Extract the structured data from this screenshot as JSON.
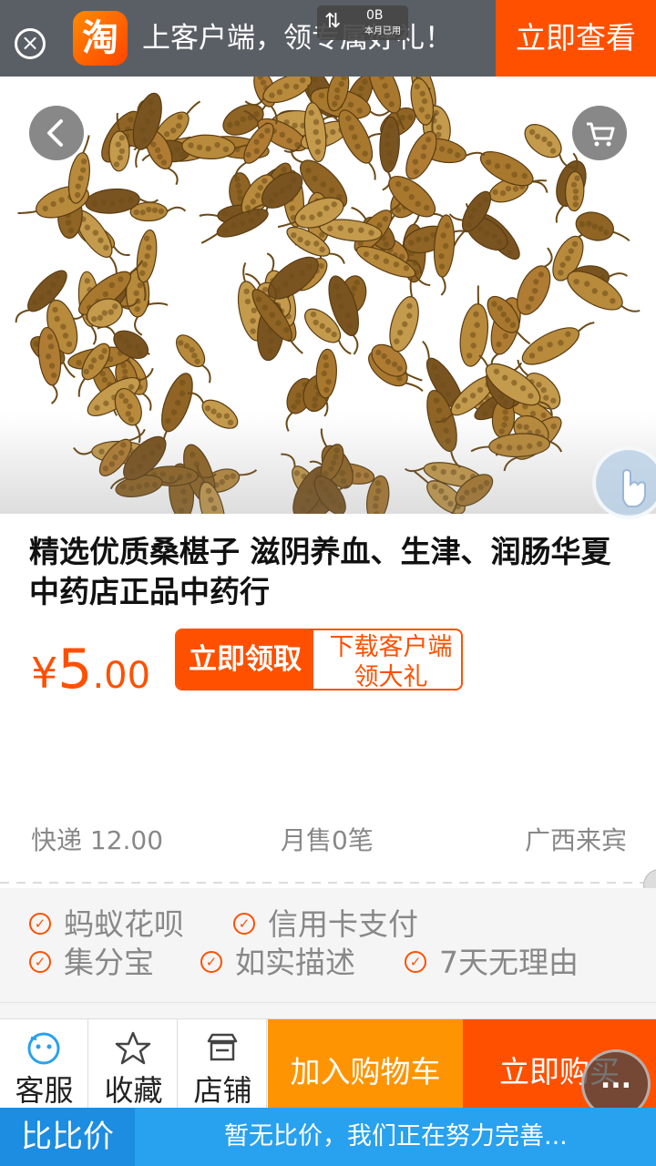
{
  "banner": {
    "logo_char": "淘",
    "text": "上客户端，领专属好礼！",
    "cta": "立即查看",
    "colors": {
      "bg": "#5a5f65",
      "cta": "#ff5000"
    }
  },
  "data_usage": {
    "amount": "0B",
    "label": "本月已用"
  },
  "product": {
    "title": "精选优质桑椹子 滋阴养血、生津、润肠华夏中药店正品中药行",
    "price_symbol": "¥",
    "price_integer": "5",
    "price_decimal": ".00"
  },
  "coupon": {
    "button": "立即领取",
    "desc": "下载客户端领大礼"
  },
  "shipping": {
    "express": "快递 12.00",
    "monthly_sales": "月售0笔",
    "location": "广西来宾"
  },
  "services": [
    "蚂蚁花呗",
    "信用卡支付",
    "集分宝",
    "如实描述",
    "7天无理由"
  ],
  "actions": {
    "service": "客服",
    "favorite": "收藏",
    "shop": "店铺",
    "add_cart": "加入购物车",
    "buy_now": "立即购买",
    "more": "..."
  },
  "compare": {
    "label": "比比价",
    "message": "暂无比价，我们正在努力完善..."
  },
  "icons": [
    "close-icon",
    "taobao-logo-icon",
    "back-icon",
    "cart-icon",
    "service-icon",
    "star-icon",
    "shop-icon",
    "hand-icon",
    "check-icon"
  ],
  "colors": {
    "accent": "#ff5000",
    "add_cart": "#ff9402",
    "compare_bar": "#28a1ee",
    "compare_label": "#1c8de0"
  }
}
